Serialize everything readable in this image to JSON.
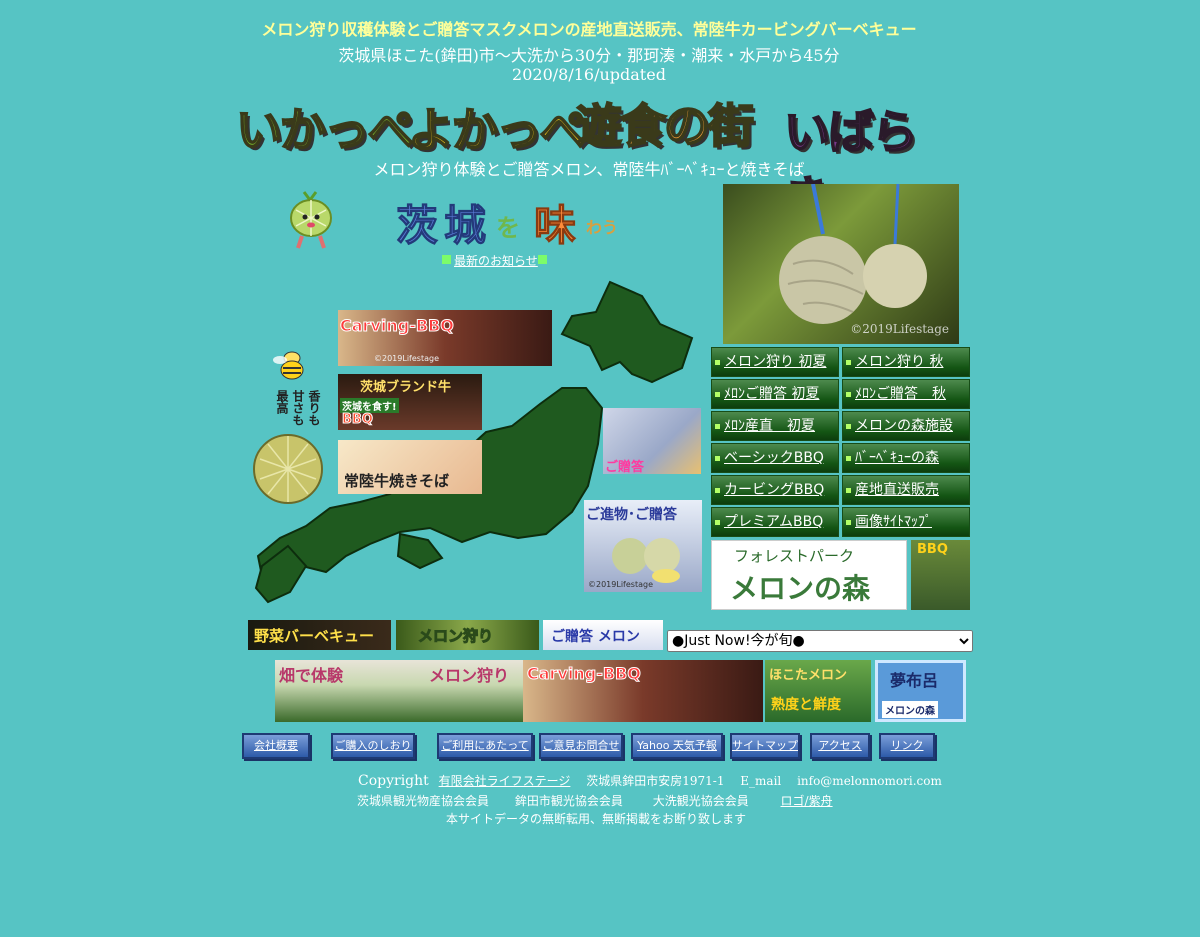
{
  "header": {
    "line1": "メロン狩り収穫体験とご贈答マスクメロンの産地直送販売、常陸牛カービングバーベキュー",
    "line2": "茨城県ほこた(鉾田)市〜大洗から30分・那珂湊・潮来・水戸から45分",
    "updated": "2020/8/16/updated"
  },
  "logos": {
    "w1": "いかっぺ",
    "w2": "よかっぺ",
    "w3": "遊食の街",
    "w4": "いばらき"
  },
  "subtitle": "メロン狩り体験とご贈答メロン、常陸牛ﾊﾞｰﾍﾞｷｭｰと焼きそば",
  "ibaraki_logo": {
    "a": "茨",
    "b": "城",
    "c": "を",
    "d": "味",
    "e": "わう"
  },
  "news_link": "最新のお知らせ",
  "bee_text": {
    "l1": "香りも",
    "l2": "甘さも",
    "l3": "最高"
  },
  "photo_credit": "©2019Lifestage",
  "map_banners": {
    "carving": "Carving-BBQ",
    "brand_beef": "茨城ブランド牛",
    "brand_sub": "茨城を食す!",
    "bbq": "BBQ",
    "yakisoba": "常陸牛焼きそば",
    "gift": "ご贈答",
    "gift_main": "ご進物･ご贈答",
    "credit_small": "©2019Lifestage"
  },
  "nav": [
    "メロン狩り 初夏",
    "メロン狩り 秋",
    "ﾒﾛﾝご贈答 初夏",
    "ﾒﾛﾝご贈答　秋",
    "ﾒﾛﾝ産直　初夏",
    "メロンの森施設",
    "ベーシックBBQ",
    "ﾊﾞｰﾍﾞｷｭｰの森",
    "カービングBBQ",
    "産地直送販売",
    "プレミアムBBQ",
    "画像ｻｲﾄﾏｯﾌﾟ"
  ],
  "forest": {
    "top": "フォレストパーク",
    "main": "メロンの森",
    "bbq": "BBQ"
  },
  "row_banners": {
    "veg": "野菜バーベキュー",
    "melon": "メロン狩り",
    "gift": "ご贈答 メロン"
  },
  "select": {
    "value": "●Just Now!今が旬●"
  },
  "bottom_banners": {
    "field_a": "畑で体験",
    "field_b": "メロン狩り",
    "carving": "Carving-BBQ",
    "hokota_a": "ほこたメロン",
    "hokota_b": "熟度と鮮度",
    "yume_a": "夢布呂",
    "yume_b": "メロンの森"
  },
  "footer_buttons": [
    "会社概要",
    "ご購入のしおり",
    "ご利用にあたって",
    "ご意見お問合せ",
    "Yahoo 天気予報",
    "サイトマップ",
    "アクセス",
    "リンク"
  ],
  "footer": {
    "copyright": "Copyright",
    "company": "有限会社ライフステージ",
    "address": "茨城県鉾田市安房1971-1",
    "email_label": "E_mail",
    "email": "info@melonnomori.com",
    "member1": "茨城県観光物産協会会員",
    "member2": "鉾田市観光協会会員",
    "member3": "大洗観光協会会員",
    "logo_credit": "ロゴ/紫舟",
    "notice": "本サイトデータの無断転用、無断掲載をお断り致します"
  }
}
